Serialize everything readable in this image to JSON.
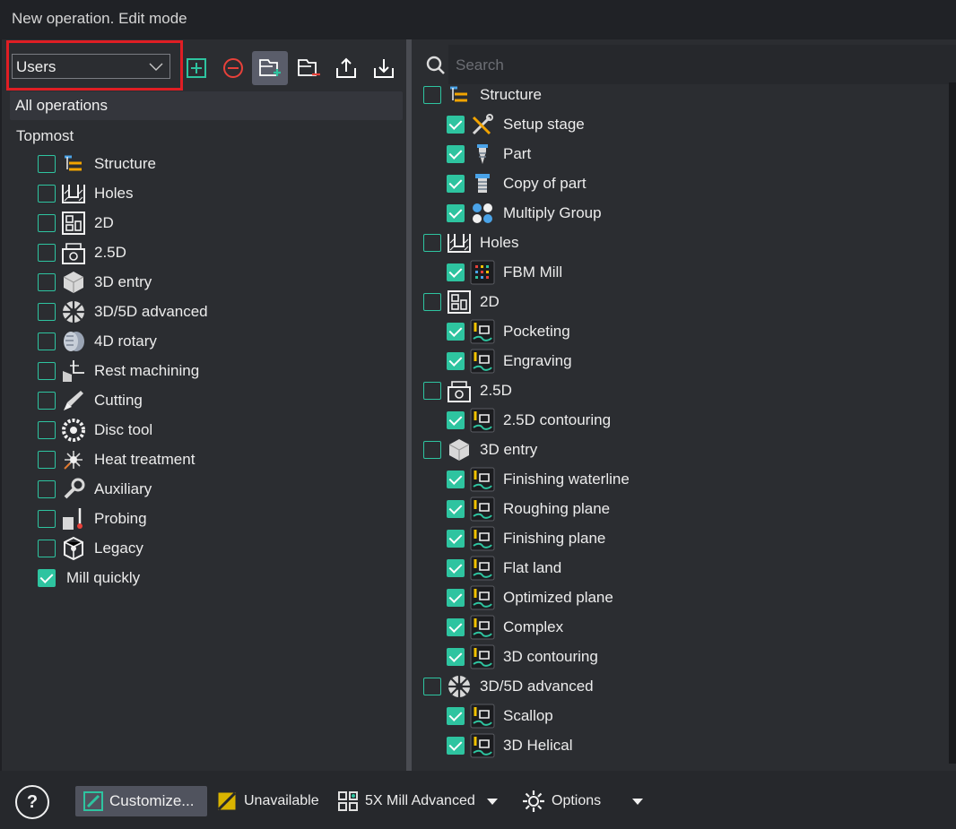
{
  "window": {
    "title": "New operation. Edit mode"
  },
  "group_selector": {
    "value": "Users"
  },
  "toolbar": {
    "add": "add-group",
    "remove": "remove-group",
    "add_folder": "add-folder",
    "remove_folder": "remove-folder",
    "export": "export",
    "import": "import"
  },
  "left": {
    "all_operations": "All operations",
    "topmost": "Topmost",
    "items": [
      {
        "label": "Structure",
        "icon": "structure-icon",
        "checked": false
      },
      {
        "label": "Holes",
        "icon": "holes-icon",
        "checked": false
      },
      {
        "label": "2D",
        "icon": "2d-icon",
        "checked": false
      },
      {
        "label": "2.5D",
        "icon": "2-5d-icon",
        "checked": false
      },
      {
        "label": "3D entry",
        "icon": "3d-entry-icon",
        "checked": false
      },
      {
        "label": "3D/5D advanced",
        "icon": "3d5d-advanced-icon",
        "checked": false
      },
      {
        "label": "4D rotary",
        "icon": "4d-rotary-icon",
        "checked": false
      },
      {
        "label": "Rest machining",
        "icon": "rest-machining-icon",
        "checked": false
      },
      {
        "label": "Cutting",
        "icon": "cutting-icon",
        "checked": false
      },
      {
        "label": "Disc tool",
        "icon": "disc-tool-icon",
        "checked": false
      },
      {
        "label": "Heat treatment",
        "icon": "heat-treatment-icon",
        "checked": false
      },
      {
        "label": "Auxiliary",
        "icon": "auxiliary-icon",
        "checked": false
      },
      {
        "label": "Probing",
        "icon": "probing-icon",
        "checked": false
      },
      {
        "label": "Legacy",
        "icon": "legacy-icon",
        "checked": false
      },
      {
        "label": "Mill quickly",
        "icon": "",
        "checked": true
      }
    ]
  },
  "right": {
    "search_placeholder": "Search",
    "items": [
      {
        "label": "Structure",
        "icon": "structure-icon",
        "checked": false,
        "level": 0
      },
      {
        "label": "Setup stage",
        "icon": "setup-stage-icon",
        "checked": true,
        "level": 1
      },
      {
        "label": "Part",
        "icon": "part-icon",
        "checked": true,
        "level": 1
      },
      {
        "label": "Copy of part",
        "icon": "copy-of-part-icon",
        "checked": true,
        "level": 1
      },
      {
        "label": "Multiply Group",
        "icon": "multiply-group-icon",
        "checked": true,
        "level": 1
      },
      {
        "label": "Holes",
        "icon": "holes-icon",
        "checked": false,
        "level": 0
      },
      {
        "label": "FBM Mill",
        "icon": "fbm-mill-icon",
        "checked": true,
        "level": 1
      },
      {
        "label": "2D",
        "icon": "2d-icon",
        "checked": false,
        "level": 0
      },
      {
        "label": "Pocketing",
        "icon": "pocketing-icon",
        "checked": true,
        "level": 1
      },
      {
        "label": "Engraving",
        "icon": "engraving-icon",
        "checked": true,
        "level": 1
      },
      {
        "label": "2.5D",
        "icon": "2-5d-icon",
        "checked": false,
        "level": 0
      },
      {
        "label": "2.5D contouring",
        "icon": "2-5d-contouring-icon",
        "checked": true,
        "level": 1
      },
      {
        "label": "3D entry",
        "icon": "3d-entry-icon",
        "checked": false,
        "level": 0
      },
      {
        "label": "Finishing waterline",
        "icon": "finishing-waterline-icon",
        "checked": true,
        "level": 1
      },
      {
        "label": "Roughing plane",
        "icon": "roughing-plane-icon",
        "checked": true,
        "level": 1
      },
      {
        "label": "Finishing plane",
        "icon": "finishing-plane-icon",
        "checked": true,
        "level": 1
      },
      {
        "label": "Flat land",
        "icon": "flat-land-icon",
        "checked": true,
        "level": 1
      },
      {
        "label": "Optimized plane",
        "icon": "optimized-plane-icon",
        "checked": true,
        "level": 1
      },
      {
        "label": "Complex",
        "icon": "complex-icon",
        "checked": true,
        "level": 1
      },
      {
        "label": "3D contouring",
        "icon": "3d-contouring-icon",
        "checked": true,
        "level": 1
      },
      {
        "label": "3D/5D advanced",
        "icon": "3d5d-advanced-icon",
        "checked": false,
        "level": 0
      },
      {
        "label": "Scallop",
        "icon": "scallop-icon",
        "checked": true,
        "level": 1
      },
      {
        "label": "3D Helical",
        "icon": "3d-helical-icon",
        "checked": true,
        "level": 1
      }
    ]
  },
  "footer": {
    "help": "?",
    "customize": "Customize...",
    "unavailable": "Unavailable",
    "machine": "5X Mill Advanced",
    "options": "Options"
  },
  "colors": {
    "accent": "#2ec4a0",
    "highlight": "#e01e24",
    "remove": "#e8413a"
  }
}
